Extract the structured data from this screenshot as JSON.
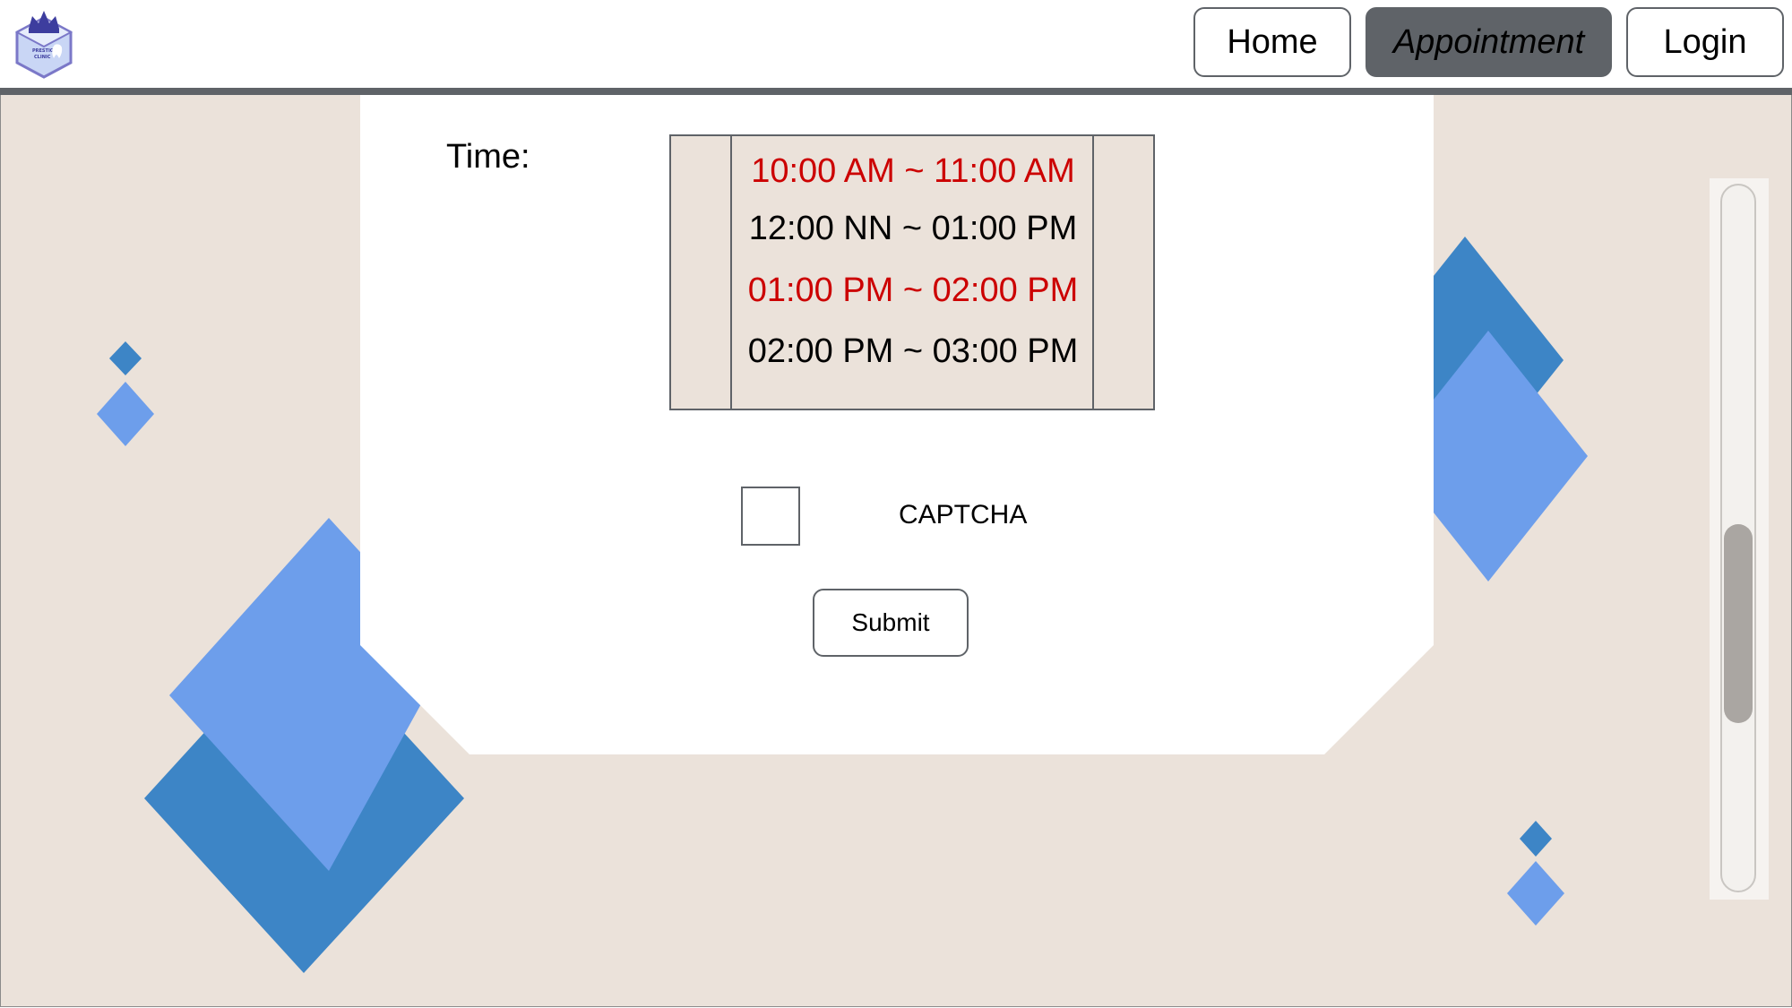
{
  "header": {
    "logo_text": "PRESTIGE CLINIC",
    "nav": {
      "home_label": "Home",
      "appointment_label": "Appointment",
      "login_label": "Login"
    }
  },
  "form": {
    "time_label": "Time:",
    "time_slots": [
      {
        "label": "10:00 AM ~ 11:00 AM",
        "status_color": "#cc0000"
      },
      {
        "label": "12:00 NN ~ 01:00 PM",
        "status_color": "#000000"
      },
      {
        "label": "01:00 PM ~ 02:00 PM",
        "status_color": "#cc0000"
      },
      {
        "label": "02:00 PM ~ 03:00 PM",
        "status_color": "#000000"
      }
    ],
    "captcha_label": "CAPTCHA",
    "submit_label": "Submit"
  },
  "colors": {
    "background": "#ebe2da",
    "accent_dark": "#3d85c6",
    "accent_light": "#6d9eeb",
    "nav_active": "#5f6368",
    "unavailable": "#cc0000"
  }
}
